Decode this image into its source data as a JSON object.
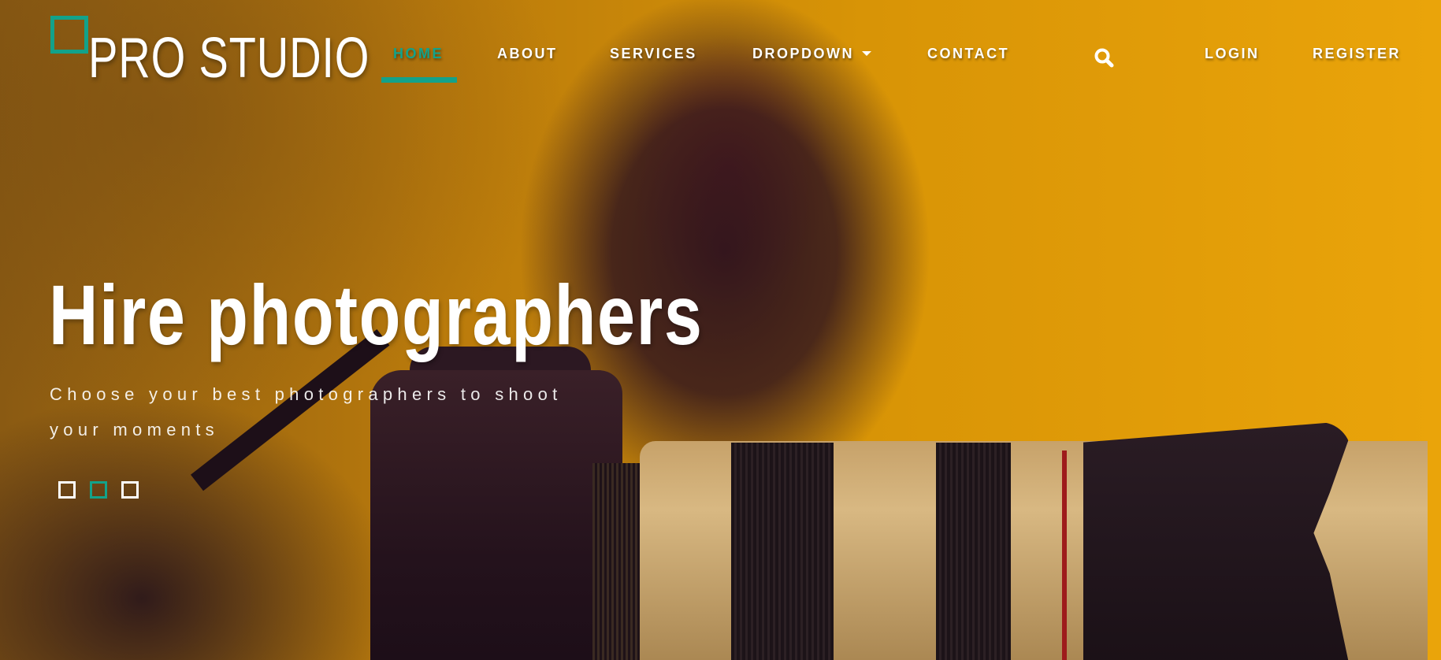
{
  "brand": {
    "name": "PRO STUDIO",
    "accent_color": "#13a28a"
  },
  "nav": {
    "items": [
      {
        "label": "HOME",
        "active": true
      },
      {
        "label": "ABOUT",
        "active": false
      },
      {
        "label": "SERVICES",
        "active": false
      },
      {
        "label": "DROPDOWN",
        "active": false,
        "has_caret": true
      },
      {
        "label": "CONTACT",
        "active": false
      }
    ],
    "search_icon": "search-icon",
    "auth": {
      "login": "LOGIN",
      "register": "REGISTER"
    }
  },
  "hero": {
    "title": "Hire photographers",
    "subtitle": "Choose your best photographers to shoot your moments",
    "slider": {
      "slide_count": 3,
      "active_index": 1
    }
  }
}
